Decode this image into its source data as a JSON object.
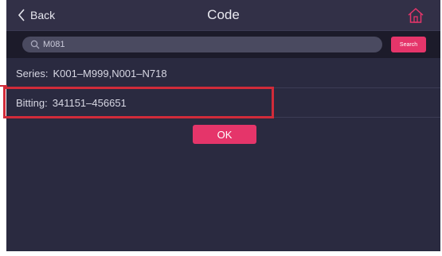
{
  "header": {
    "back_label": "Back",
    "title": "Code",
    "back_icon": "chevron-left-icon",
    "home_icon": "home-icon"
  },
  "search": {
    "value": "M081",
    "search_icon": "search-icon",
    "button_label": "Search"
  },
  "results": {
    "series_label": "Series:",
    "series_value": "K001–M999,N001–N718",
    "bitting_label": "Bitting:",
    "bitting_value": "341151–456651"
  },
  "actions": {
    "ok_label": "OK"
  },
  "colors": {
    "background": "#2a2a40",
    "accent": "#e5356a",
    "highlight": "#d12b39"
  }
}
